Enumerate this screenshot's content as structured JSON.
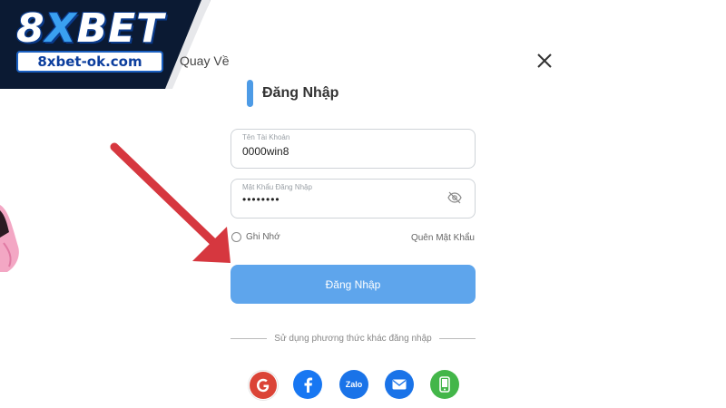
{
  "logo": {
    "brand_pre": "8",
    "brand_x": "X",
    "brand_post": "BET",
    "url": "8xbet-ok.com"
  },
  "nav": {
    "back_label": "Quay Về",
    "close_icon": "close-icon"
  },
  "form": {
    "title": "Đăng Nhập",
    "username": {
      "label": "Tên Tài Khoản",
      "value": "0000win8"
    },
    "password": {
      "label": "Mật Khẩu Đăng Nhập",
      "value": "••••••••",
      "toggle_icon": "eye-off-icon"
    },
    "remember_label": "Ghi Nhớ",
    "forgot_label": "Quên Mật Khẩu",
    "submit_label": "Đăng Nhập",
    "alt_login_label": "Sử dụng phương thức khác đăng nhập"
  },
  "social": [
    {
      "name": "google",
      "icon": "google-icon",
      "color": "#db4437"
    },
    {
      "name": "facebook",
      "icon": "facebook-icon",
      "color": "#1877f2"
    },
    {
      "name": "zalo",
      "icon": "zalo-icon",
      "label": "Zalo",
      "color": "#1a73e8"
    },
    {
      "name": "email",
      "icon": "mail-icon",
      "color": "#1a73e8"
    },
    {
      "name": "phone",
      "icon": "phone-icon",
      "color": "#43b649"
    }
  ],
  "colors": {
    "accent": "#5ea5ec",
    "arrow": "#d6373f",
    "logo_bg": "#0b1a33"
  }
}
